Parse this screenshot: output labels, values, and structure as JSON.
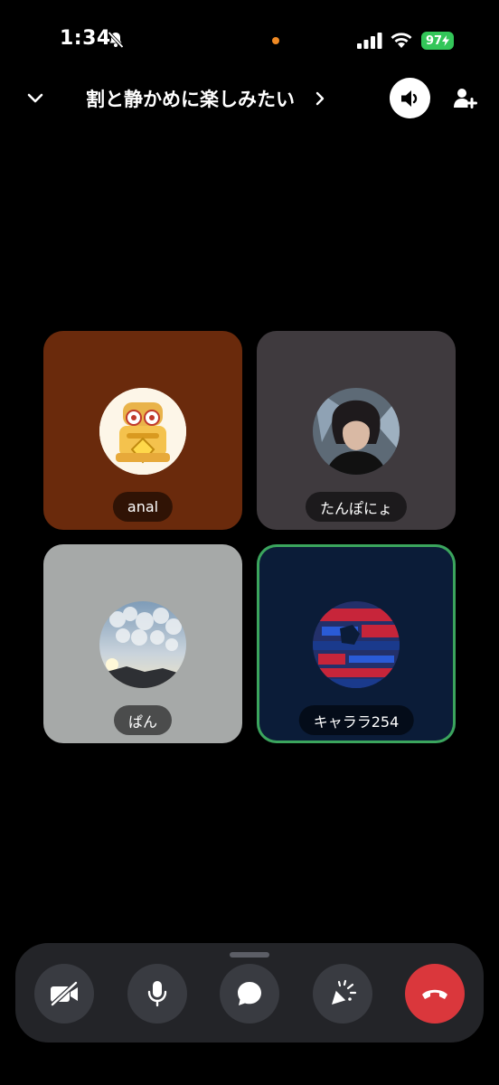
{
  "status_bar": {
    "time": "1:34",
    "battery": "97"
  },
  "header": {
    "channel_title": "割と静かめに楽しみたい"
  },
  "participants": [
    {
      "name": "anal",
      "tile_color": "#6a2a0c",
      "speaking": false
    },
    {
      "name": "たんぽにょ",
      "tile_color": "#3f3a3e",
      "speaking": false
    },
    {
      "name": "ぱん",
      "tile_color": "#a6a9a8",
      "speaking": false
    },
    {
      "name": "キャララ254",
      "tile_color": "#0b1c38",
      "speaking": true
    }
  ],
  "controls": [
    "camera-off-icon",
    "microphone-icon",
    "chat-icon",
    "activities-icon",
    "hang-up-icon"
  ],
  "colors": {
    "accent_speaking": "#3ba55d",
    "end_call": "#da373c",
    "panel": "#232428",
    "button": "#393b41"
  }
}
